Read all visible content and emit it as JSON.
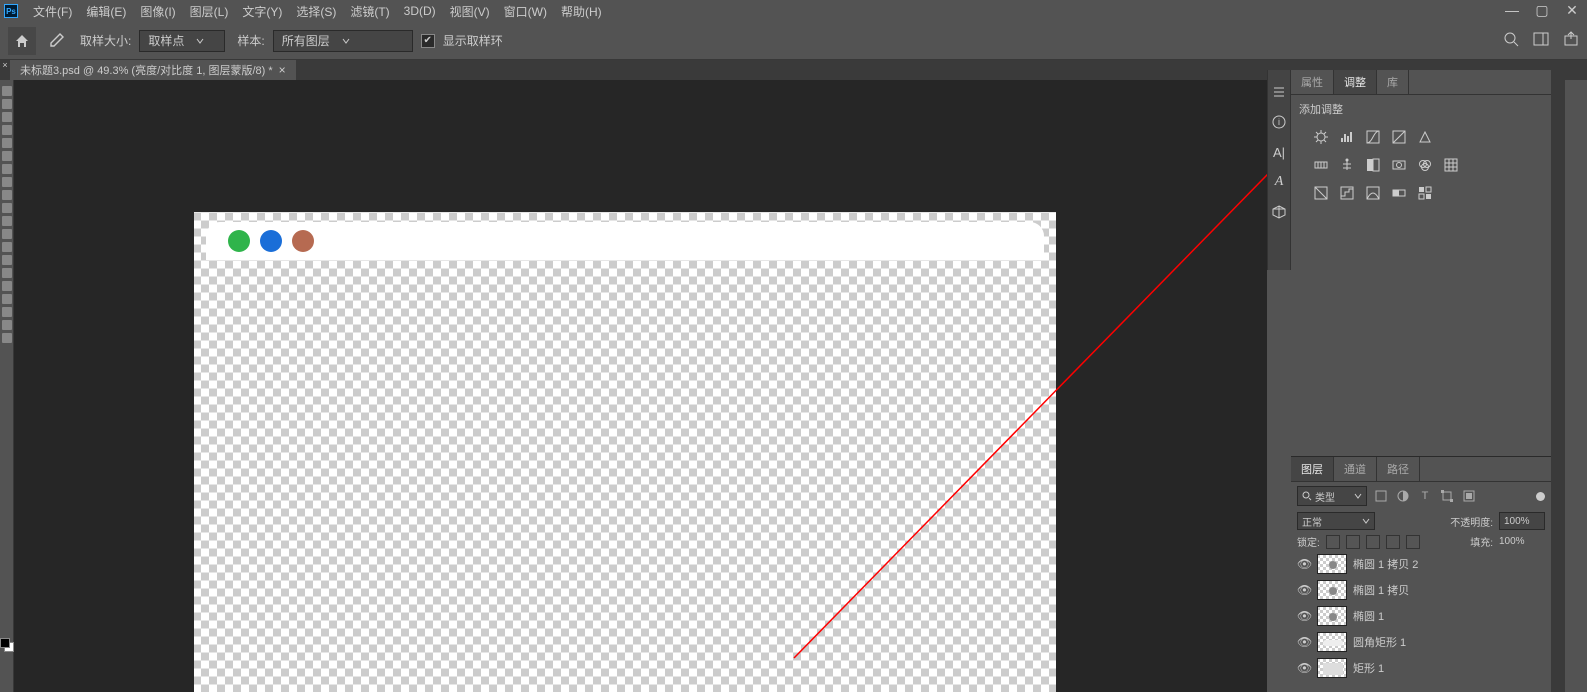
{
  "menu": {
    "items": [
      "文件(F)",
      "编辑(E)",
      "图像(I)",
      "图层(L)",
      "文字(Y)",
      "选择(S)",
      "滤镜(T)",
      "3D(D)",
      "视图(V)",
      "窗口(W)",
      "帮助(H)"
    ]
  },
  "optionsbar": {
    "sample_size_label": "取样大小:",
    "sample_size_value": "取样点",
    "sample_label": "样本:",
    "sample_value": "所有图层",
    "show_ring": "显示取样环"
  },
  "document_tab": "未标题3.psd @ 49.3% (亮度/对比度 1, 图层蒙版/8) *",
  "panels": {
    "top_tabs": [
      "属性",
      "调整",
      "库"
    ],
    "active_top_tab": 1,
    "adjustments_title": "添加调整"
  },
  "layers_panel": {
    "tabs": [
      "图层",
      "通道",
      "路径"
    ],
    "active_tab": 0,
    "filter_label": "类型",
    "blend_mode": "正常",
    "opacity_label": "不透明度:",
    "opacity_value": "100%",
    "lock_label": "锁定:",
    "fill_label": "填充:",
    "fill_value": "100%",
    "items": [
      {
        "name": "椭圆 1 拷贝 2",
        "type": "ellipse"
      },
      {
        "name": "椭圆 1 拷贝",
        "type": "ellipse"
      },
      {
        "name": "椭圆 1",
        "type": "ellipse"
      },
      {
        "name": "圆角矩形 1",
        "type": "roundrect"
      },
      {
        "name": "矩形 1",
        "type": "rect"
      }
    ]
  }
}
